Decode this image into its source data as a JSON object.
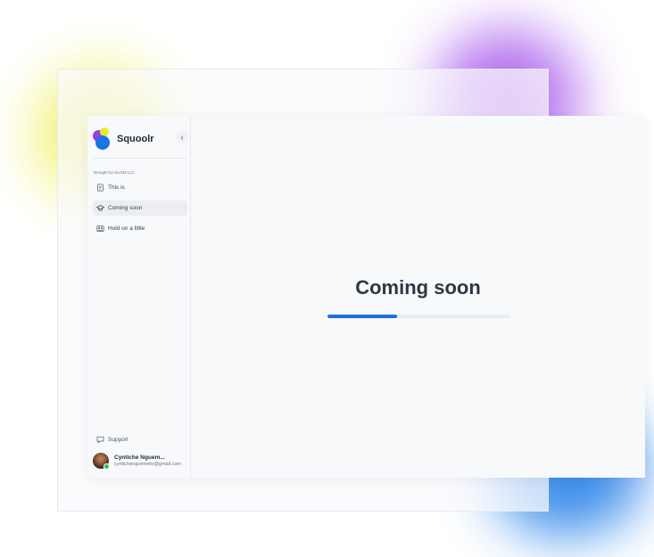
{
  "app": {
    "name": "Squoolr"
  },
  "sidebar": {
    "section_label": "Brought by GLOM LLC",
    "items": [
      {
        "label": "This is",
        "icon": "document-icon",
        "active": false
      },
      {
        "label": "Coming soon",
        "icon": "graduation-cap-icon",
        "active": true
      },
      {
        "label": "Hold on  a little",
        "icon": "people-group-icon",
        "active": false
      }
    ],
    "support_label": "Support",
    "collapse_icon": "chevron-left-icon"
  },
  "user": {
    "name": "Cyntiche Nguem...",
    "email": "cyntichenguemelo@gmail.com",
    "status": "online"
  },
  "main": {
    "title": "Coming soon",
    "progress": 0.38
  },
  "colors": {
    "accent": "#1f6fd6",
    "logo_purple": "#9b3fe0",
    "logo_yellow": "#e8ea25",
    "logo_blue": "#1a74e2"
  }
}
